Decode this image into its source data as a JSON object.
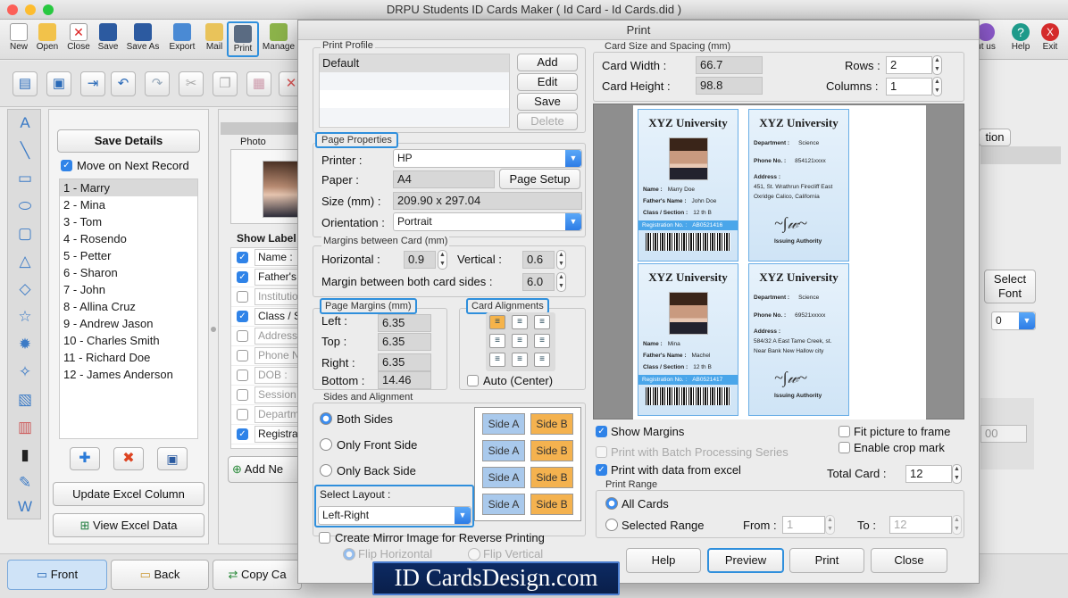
{
  "app": {
    "title": "DRPU Students ID Cards Maker ( Id Card - Id Cards.did )"
  },
  "toolbar": [
    {
      "label": "New",
      "icon": "new-icon"
    },
    {
      "label": "Open",
      "icon": "open-icon"
    },
    {
      "label": "Close",
      "icon": "close-icon"
    },
    {
      "label": "Save",
      "icon": "save-icon"
    },
    {
      "label": "Save As",
      "icon": "save-as-icon"
    },
    {
      "label": "Export",
      "icon": "export-icon"
    },
    {
      "label": "Mail",
      "icon": "mail-icon"
    },
    {
      "label": "Print",
      "icon": "print-icon"
    },
    {
      "label": "Manage",
      "icon": "manage-icon"
    }
  ],
  "toolbar_right": [
    {
      "label": "ut us",
      "icon": "about-icon"
    },
    {
      "label": "Help",
      "icon": "help-icon"
    },
    {
      "label": "Exit",
      "icon": "exit-icon"
    }
  ],
  "left_panel": {
    "save_details": "Save Details",
    "move_next": "Move on Next Record",
    "records": [
      "1 - Marry",
      "2 - Mina",
      "3 - Tom",
      "4 - Rosendo",
      "5 - Petter",
      "6 - Sharon",
      "7 - John",
      "8 - Allina Cruz",
      "9 - Andrew Jason",
      "10 - Charles Smith",
      "11 - Richard Doe",
      "12 - James Anderson"
    ],
    "update_excel": "Update Excel Column",
    "view_excel": "View Excel Data"
  },
  "mid_panel": {
    "photo_label": "Photo",
    "show_label": "Show Label",
    "fields": [
      {
        "label": "Name :",
        "checked": true
      },
      {
        "label": "Father's",
        "checked": true
      },
      {
        "label": "Institutio",
        "checked": false
      },
      {
        "label": "Class / S",
        "checked": true
      },
      {
        "label": "Address",
        "checked": false
      },
      {
        "label": "Phone N",
        "checked": false
      },
      {
        "label": "DOB :",
        "checked": false
      },
      {
        "label": "Session",
        "checked": false
      },
      {
        "label": "Departm",
        "checked": false
      },
      {
        "label": "Registra",
        "checked": true
      }
    ],
    "add_new": "Add Ne"
  },
  "bottom_tabs": {
    "front": "Front",
    "back": "Back",
    "copy": "Copy Ca"
  },
  "right_bg": {
    "tion": "tion",
    "select_font": "Select Font",
    "select_val": "0",
    "num": "00"
  },
  "dialog": {
    "title": "Print",
    "print_profile": {
      "label": "Print Profile",
      "items": [
        "Default"
      ],
      "add": "Add",
      "edit": "Edit",
      "save": "Save",
      "delete": "Delete"
    },
    "page_properties": {
      "label": "Page Properties",
      "printer_label": "Printer :",
      "printer": "HP",
      "paper_label": "Paper :",
      "paper": "A4",
      "page_setup": "Page Setup",
      "size_label": "Size (mm) :",
      "size": "209.90 x 297.04",
      "orientation_label": "Orientation :",
      "orientation": "Portrait"
    },
    "margins_between": {
      "label": "Margins between Card (mm)",
      "horizontal_label": "Horizontal :",
      "horizontal": "0.9",
      "vertical_label": "Vertical :",
      "vertical": "0.6",
      "both_label": "Margin between both card sides :",
      "both": "6.0"
    },
    "page_margins": {
      "label": "Page Margins (mm)",
      "left_label": "Left :",
      "left": "6.35",
      "top_label": "Top :",
      "top": "6.35",
      "right_label": "Right :",
      "right": "6.35",
      "bottom_label": "Bottom :",
      "bottom": "14.46"
    },
    "card_alignments": {
      "label": "Card Alignments",
      "auto": "Auto (Center)"
    },
    "sides": {
      "label": "Sides and Alignment",
      "both": "Both Sides",
      "front": "Only Front Side",
      "back": "Only Back Side",
      "layout_label": "Select Layout :",
      "layout": "Left-Right",
      "side_a": "Side A",
      "side_b": "Side B"
    },
    "mirror": {
      "label": "Create Mirror Image for Reverse Printing",
      "flip_h": "Flip Horizontal",
      "flip_v": "Flip Vertical"
    },
    "card_size": {
      "label": "Card Size and Spacing (mm)",
      "width_label": "Card Width :",
      "width": "66.7",
      "height_label": "Card Height :",
      "height": "98.8",
      "rows_label": "Rows :",
      "rows": "2",
      "columns_label": "Columns :",
      "columns": "1"
    },
    "preview_cards": [
      {
        "university": "XYZ University",
        "name": "Marry Doe",
        "father": "John Doe",
        "class": "12 th B",
        "reg": "AB0521416"
      },
      {
        "university": "XYZ University",
        "department": "Science",
        "phone": "854121xxxx",
        "address": "451, St. Wrathrun Firecliff East Oxridge Calico, California",
        "issuing": "Issuing Authority"
      },
      {
        "university": "XYZ University",
        "name": "Mina",
        "father": "Machel",
        "class": "12 th B",
        "reg": "AB0521417"
      },
      {
        "university": "XYZ University",
        "department": "Science",
        "phone": "69521xxxxx",
        "address": "584/32 A East Tame Creek, st. Near Bank New Hallow city",
        "issuing": "Issuing Authority"
      }
    ],
    "card_labels": {
      "name": "Name :",
      "father": "Father's Name :",
      "class": "Class / Section :",
      "reg": "Registration No. :",
      "department": "Department :",
      "phone": "Phone No. :",
      "address": "Address :"
    },
    "options": {
      "show_margins": "Show Margins",
      "batch": "Print with Batch Processing Series",
      "excel": "Print with data from excel",
      "fit": "Fit picture to frame",
      "crop": "Enable crop mark",
      "total_label": "Total Card :",
      "total": "12"
    },
    "print_range": {
      "label": "Print Range",
      "all": "All Cards",
      "selected": "Selected Range",
      "from_label": "From :",
      "from": "1",
      "to_label": "To :",
      "to": "12"
    },
    "buttons": {
      "help": "Help",
      "preview": "Preview",
      "print": "Print",
      "close": "Close"
    }
  },
  "watermark": "ID CardsDesign.com"
}
